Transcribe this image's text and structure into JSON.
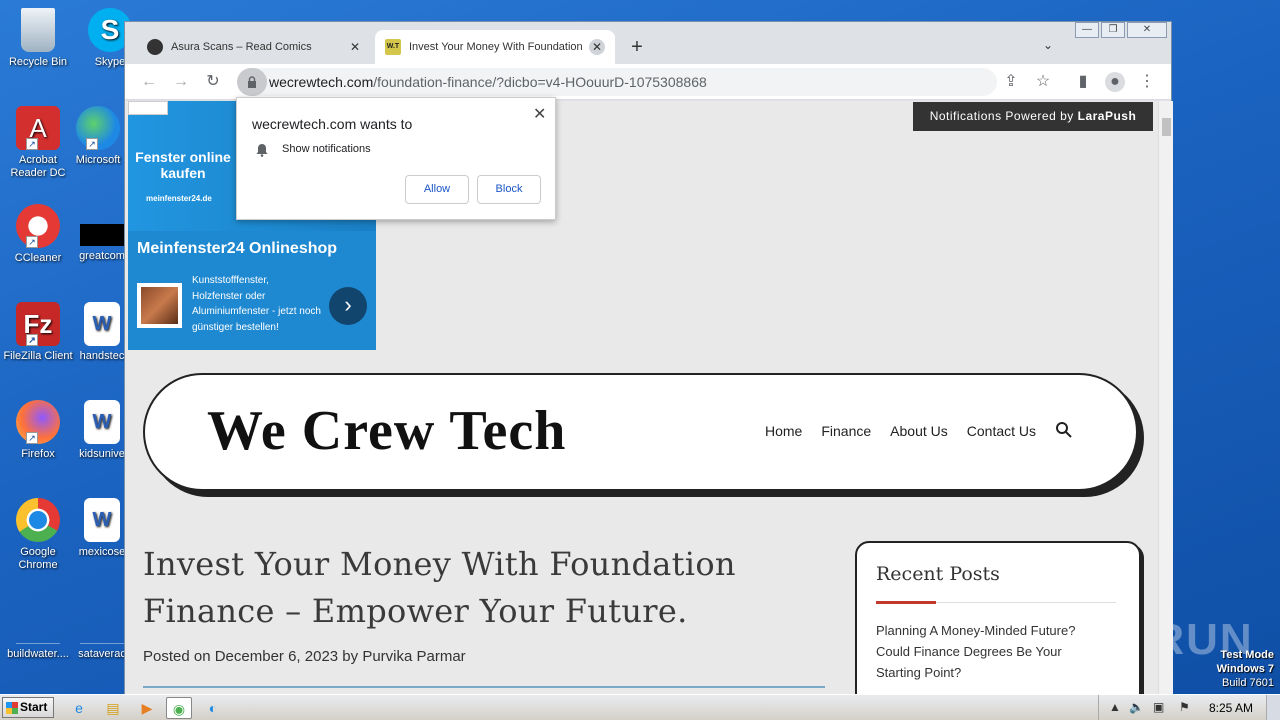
{
  "desktop": {
    "icons": [
      {
        "label": "Recycle Bin",
        "icon": "recycle-bin-icon",
        "color": "#cfd8dc"
      },
      {
        "label": "Skype",
        "icon": "skype-icon",
        "color": "#00aff0"
      },
      {
        "label": "Acrobat Reader DC",
        "icon": "acrobat-icon",
        "color": "#d32f2f"
      },
      {
        "label": "Microsoft",
        "icon": "edge-icon",
        "color": "#1e88e5"
      },
      {
        "label": "CCleaner",
        "icon": "ccleaner-icon",
        "color": "#e53935"
      },
      {
        "label": "greatcom",
        "icon": "black-file-icon",
        "color": "#000000"
      },
      {
        "label": "FileZilla Client",
        "icon": "filezilla-icon",
        "color": "#c62828"
      },
      {
        "label": "handstec",
        "icon": "word-doc-icon",
        "color": "#ffffff"
      },
      {
        "label": "Firefox",
        "icon": "firefox-icon",
        "color": "#ff7139"
      },
      {
        "label": "kidsunive",
        "icon": "word-doc-icon",
        "color": "#ffffff"
      },
      {
        "label": "Google Chrome",
        "icon": "chrome-icon",
        "color": "#4caf50"
      },
      {
        "label": "mexicose",
        "icon": "word-doc-icon",
        "color": "#ffffff"
      },
      {
        "label": "buildwater....",
        "icon": "blank-file-icon",
        "color": "#1b63c0"
      },
      {
        "label": "sataverac",
        "icon": "blank-file-icon",
        "color": "#1b63c0"
      }
    ],
    "watermark": "ANY RUN",
    "test_mode": {
      "line1": "Test Mode",
      "line2": "Windows 7",
      "line3": "Build 7601"
    }
  },
  "browser": {
    "tabs": [
      {
        "title": "Asura Scans – Read Comics",
        "close": "✕"
      },
      {
        "title": "Invest Your Money With Foundation",
        "close": "✕",
        "favicon_text": "W.T"
      }
    ],
    "new_tab": "+",
    "tab_search": "⌄",
    "window_buttons": {
      "minimize": "—",
      "maximize": "❐",
      "close": "✕"
    },
    "nav": {
      "back": "←",
      "forward": "→",
      "reload": "↻"
    },
    "url_host": "wecrewtech.com",
    "url_path": "/foundation-finance/?dicbo=v4-HOouurD-1075308868",
    "actions": {
      "share": "⇪",
      "bookmark": "☆",
      "sidepanel": "▮",
      "profile": "●",
      "menu": "⋮"
    }
  },
  "page": {
    "larapush": {
      "text": "Notifications Powered by ",
      "brand": "LaraPush"
    },
    "ad": {
      "headline": "Fenster online kaufen",
      "domain": "meinfenster24.de",
      "title": "Meinfenster24 Onlineshop",
      "text": "Kunststofffenster, Holzfenster oder Aluminiumfenster - jetzt noch günstiger bestellen!",
      "arrow": "›"
    },
    "site": {
      "logo": "We Crew Tech",
      "nav": [
        "Home",
        "Finance",
        "About Us",
        "Contact Us"
      ]
    },
    "post": {
      "title": "Invest Your Money With Foundation Finance – Empower Your Future.",
      "meta_prefix": "Posted on ",
      "date": "December 6, 2023",
      "meta_by": " by ",
      "author": "Purvika Parmar"
    },
    "sidebar": {
      "title": "Recent Posts",
      "posts": [
        "Planning A Money-Minded Future? Could Finance Degrees Be Your Starting Point?"
      ]
    }
  },
  "notification": {
    "title": "wecrewtech.com wants to",
    "line": "Show notifications",
    "allow": "Allow",
    "block": "Block",
    "close": "✕"
  },
  "taskbar": {
    "start": "Start",
    "clock": "8:25 AM"
  },
  "colors": {
    "accent_red": "#c0392b",
    "link_blue": "#1a56c4",
    "larapush_bg": "#333333"
  }
}
